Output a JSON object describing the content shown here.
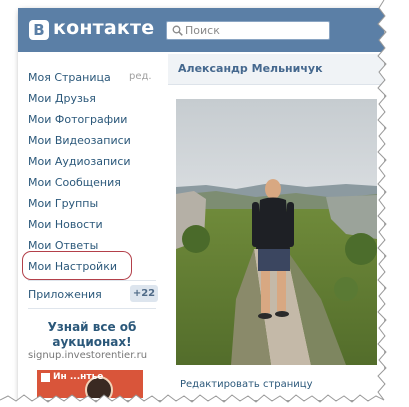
{
  "header": {
    "logo_letter": "В",
    "logo_text": "контакте",
    "search_placeholder": "Поиск"
  },
  "sidebar": {
    "items": [
      {
        "label": "Моя Страница"
      },
      {
        "label": "Мои Друзья"
      },
      {
        "label": "Мои Фотографии"
      },
      {
        "label": "Мои Видеозаписи"
      },
      {
        "label": "Мои Аудиозаписи"
      },
      {
        "label": "Мои Сообщения"
      },
      {
        "label": "Мои Группы"
      },
      {
        "label": "Мои Новости"
      },
      {
        "label": "Мои Ответы"
      },
      {
        "label": "Мои Настройки"
      }
    ],
    "edit_label": "ред.",
    "apps_label": "Приложения",
    "apps_count": "+22"
  },
  "ad": {
    "title": "Узнай все об аукционах!",
    "url": "signup.investorentier.ru",
    "banner_text": "Ин ...нтье"
  },
  "profile": {
    "name": "Александр Мельничук",
    "edit_link": "Редактировать страницу"
  },
  "colors": {
    "header_bg": "#5b7fa6",
    "link": "#2b587a",
    "highlight_outline": "#b3404a",
    "ad_banner": "#d9553a"
  }
}
